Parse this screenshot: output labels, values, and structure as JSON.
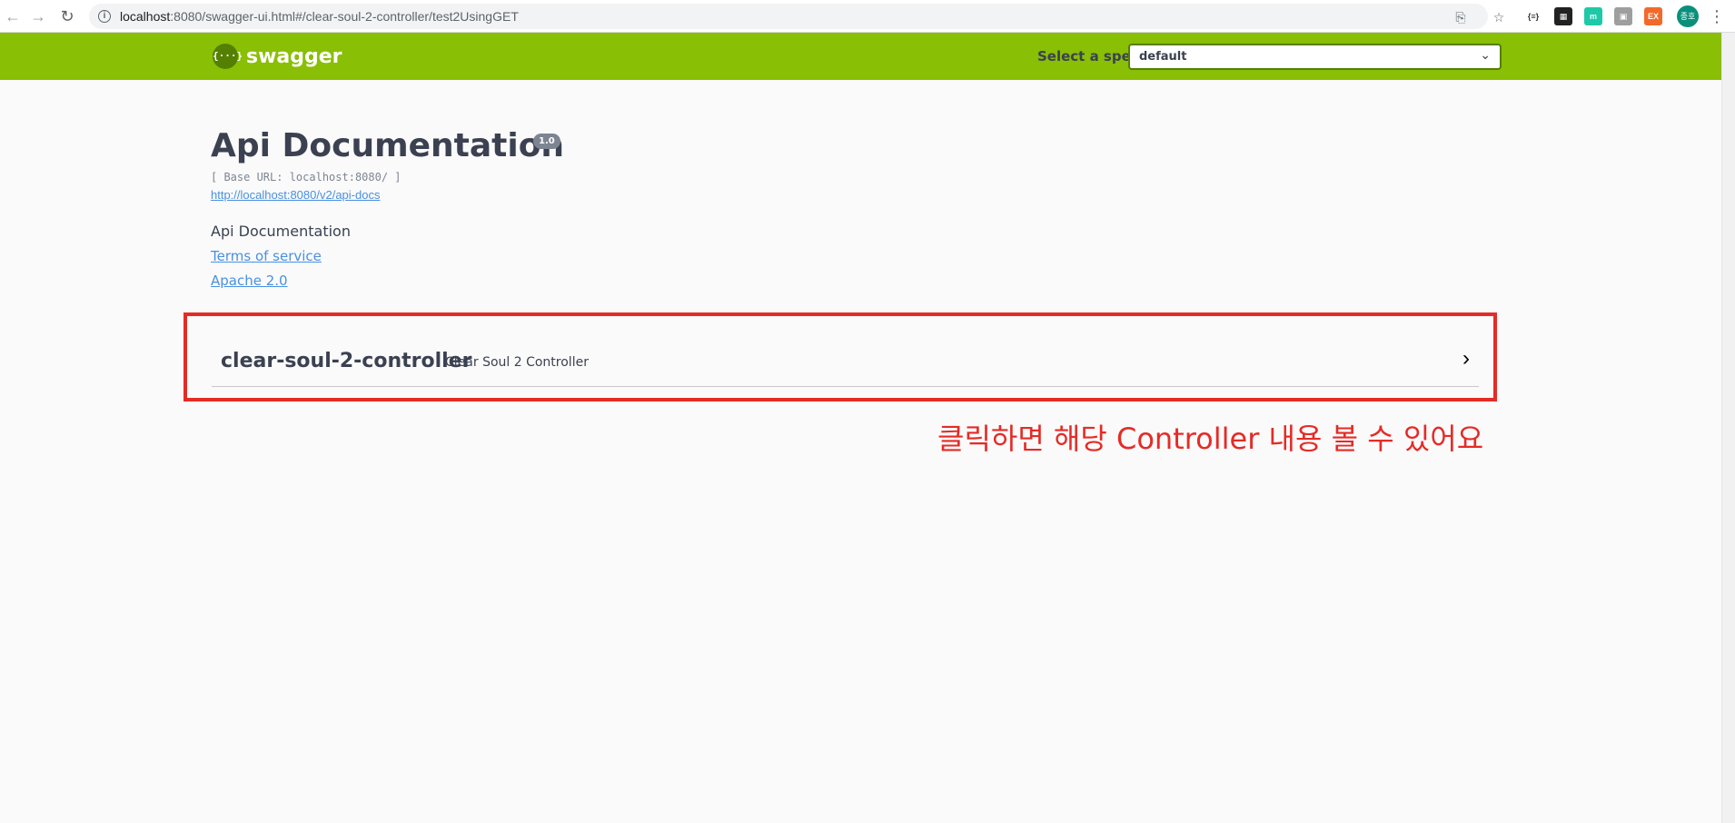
{
  "browser": {
    "url_host": "localhost",
    "url_rest": ":8080/swagger-ui.html#/clear-soul-2-controller/test2UsingGET",
    "back_icon": "←",
    "forward_icon": "→",
    "reload_icon": "↻",
    "extensions": [
      {
        "name": "json-viewer-ext",
        "label": "{≡}",
        "color": "#ffffff",
        "text_color": "#333333"
      },
      {
        "name": "qr-ext",
        "label": "▦",
        "color": "#222222",
        "text_color": "#ffffff"
      },
      {
        "name": "m-ext",
        "label": "m",
        "color": "#1ec9a8",
        "text_color": "#ffffff"
      },
      {
        "name": "photo-ext",
        "label": "▣",
        "color": "#9e9e9e",
        "text_color": "#ffffff"
      },
      {
        "name": "ex-ext",
        "label": "EX",
        "color": "#f26a2b",
        "text_color": "#ffffff"
      }
    ],
    "profile_initials": "종호",
    "menu_icon": "⋮"
  },
  "topbar": {
    "logo_mark": "{···}",
    "logo_text": "swagger",
    "spec_label": "Select a spec",
    "spec_value": "default",
    "chevron_icon": "⌄",
    "bg_color": "#89bf04"
  },
  "info": {
    "title": "Api Documentation",
    "version": "1.0",
    "base_url": "[ Base URL: localhost:8080/ ]",
    "api_docs_link": "http://localhost:8080/v2/api-docs",
    "description": "Api Documentation",
    "terms_link": "Terms of service",
    "license_link": "Apache 2.0"
  },
  "tags": [
    {
      "name": "clear-soul-2-controller",
      "description": "Clear Soul 2 Controller",
      "chevron": "›"
    }
  ],
  "annotation": {
    "text": "클릭하면 해당 Controller 내용 볼 수 있어요",
    "color": "#e52b26"
  }
}
